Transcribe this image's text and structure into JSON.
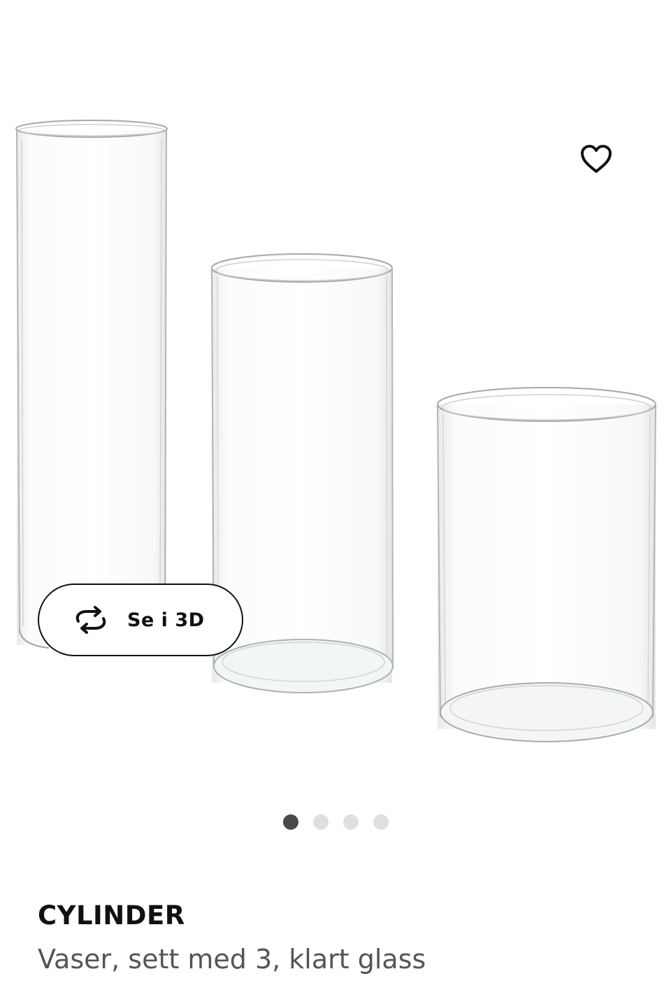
{
  "gallery": {
    "image_alt": "CYLINDER vaser, sett med 3, klart glass",
    "favorite_icon": "heart-outline-icon",
    "view3d": {
      "icon": "rotate-arrows-icon",
      "label": "Se i 3D"
    },
    "pagination": {
      "total": 4,
      "active": 1
    }
  },
  "product": {
    "name": "CYLINDER",
    "description": "Vaser, sett med 3, klart glass"
  },
  "colors": {
    "text_primary": "#111111",
    "text_secondary": "#555555",
    "dot_active": "#484848",
    "dot_inactive": "#dfdfdf"
  }
}
